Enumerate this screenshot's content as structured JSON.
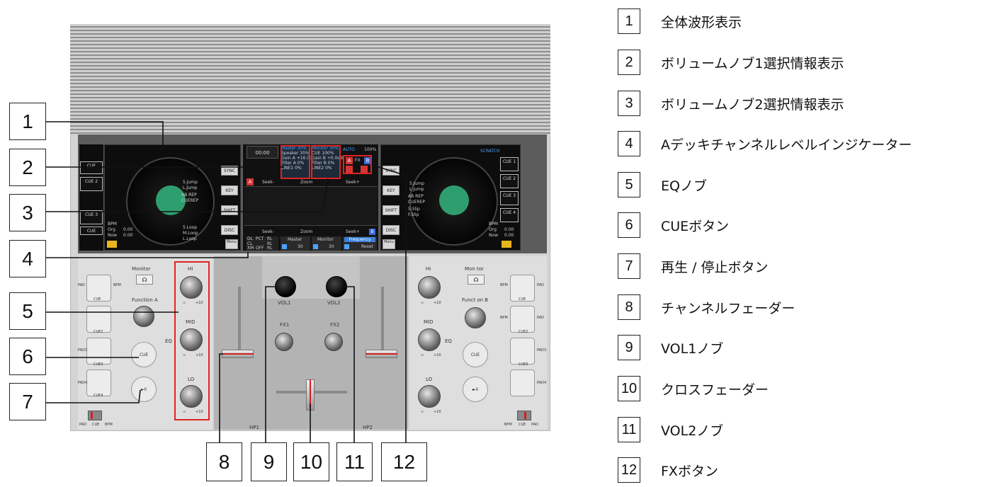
{
  "legend": [
    {
      "num": "1",
      "text": "全体波形表示"
    },
    {
      "num": "2",
      "text": "ボリュームノブ1選択情報表示"
    },
    {
      "num": "3",
      "text": "ボリュームノブ2選択情報表示"
    },
    {
      "num": "4",
      "text": "Aデッキチャンネルレベルインジケーター"
    },
    {
      "num": "5",
      "text": "EQノブ"
    },
    {
      "num": "6",
      "text": "CUEボタン"
    },
    {
      "num": "7",
      "text": "再生 / 停止ボタン"
    },
    {
      "num": "8",
      "text": "チャンネルフェーダー"
    },
    {
      "num": "9",
      "text": "VOL1ノブ"
    },
    {
      "num": "10",
      "text": "クロスフェーダー"
    },
    {
      "num": "11",
      "text": "VOL2ノブ"
    },
    {
      "num": "12",
      "text": "FXボタン"
    }
  ],
  "device": {
    "screen": {
      "time": "00:00",
      "deckA_cues": [
        "CUE",
        "CUE 2",
        "CUE 3",
        "CUE"
      ],
      "deckB_cues": [
        "CUE 1",
        "CUE 2",
        "CUE 3",
        "CUE 4"
      ],
      "deck_side_buttons": [
        "SYNC",
        "KEY",
        "SHIFT",
        "DISC"
      ],
      "jump_labels": [
        "5.Jump",
        "L.Jump",
        "AB REP",
        "CUEREP",
        "5.Slip",
        "F.Slip",
        "5.Loop",
        "M.Loop",
        "L.Loop"
      ],
      "bpm_label": "BPM",
      "org_label": "Org",
      "now_label": "Now",
      "bpm_value": "0.00",
      "scratch_label": "SCRATCH",
      "menu_label": "Menu",
      "deck_letter_a": "A",
      "deck_letter_b": "B",
      "seek_minus": "Seek-",
      "seek_plus": "Seek+",
      "zoom": "Zoom",
      "auto_label": "AUTO",
      "auto_percent": "100%",
      "fx_label": "FX",
      "master_label": "Master",
      "monitor_label": "Monitor",
      "frequency_label": "Frequency",
      "reset_label": "Reset",
      "vol_value_1": "30",
      "vol_value_2": "30",
      "vol1_info": [
        "Master 30%",
        "Speaker 30%",
        "Gain A +16.0dB",
        "Filter A 0%",
        "LINE1 0%"
      ],
      "vol2_info": [
        "Monitor 30%",
        "CUE 100%",
        "Gain B +0.0dB",
        "Filter B 0%",
        "LINE2 0%"
      ],
      "level_labels": [
        "DL",
        "PCT",
        "RL",
        "CL",
        "RL",
        "XM",
        "OFF",
        "RL"
      ]
    },
    "controls": {
      "monitor_left": "Monitor",
      "monitor_right": "Mon tor",
      "function_a": "Function A",
      "function_b": "Funct on B",
      "hi": "HI",
      "hi_right": "Hi",
      "mid": "MID",
      "lo": "LO",
      "eq": "EQ",
      "minus_inf": "∞",
      "plus_ten": "+10",
      "cue": "CUE",
      "play_pause": "►II",
      "vol1": "VOL1",
      "vol2": "VOL2",
      "fx1": "FX1",
      "fx2": "FX2",
      "hp1": "HP1",
      "hp2": "HP2",
      "pad_labels_left": [
        "PAD",
        "BPM",
        "CUE",
        "CUE2",
        "PAD3",
        "CUE3",
        "PAD4",
        "CUE4"
      ],
      "pad_labels_right": [
        "BPM",
        "PAD",
        "CUE",
        "BPM",
        "PAD",
        "CUE2",
        "PAD3",
        "CUE3",
        "PAD4"
      ],
      "mode_left": [
        "PAD",
        "CUE",
        "BPM"
      ],
      "mode_right": [
        "BPM",
        "CUE",
        "PAD"
      ]
    }
  }
}
